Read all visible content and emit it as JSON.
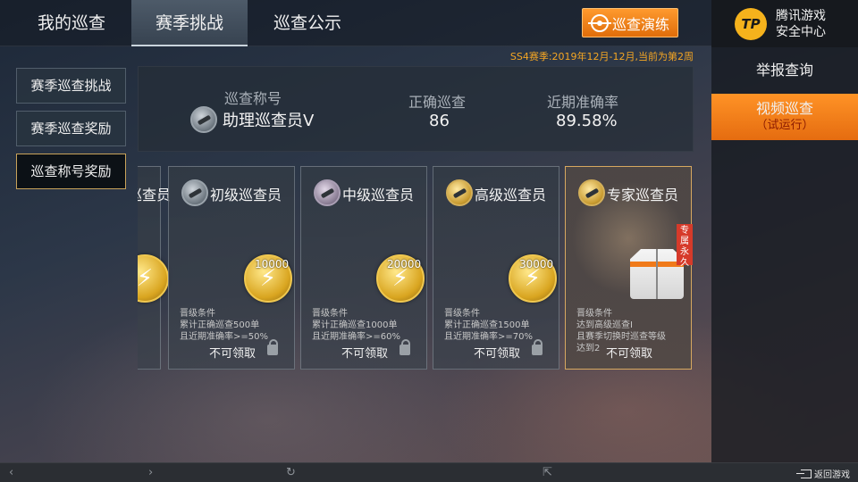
{
  "top_tabs": [
    "我的巡查",
    "赛季挑战",
    "巡查公示"
  ],
  "active_tab": "赛季挑战",
  "drill_button": {
    "label": "巡查演练",
    "icon": "crosshair-icon"
  },
  "season_info": "SS4赛季:2019年12月-12月,当前为第2周",
  "right_panel": {
    "logo_text": "TP",
    "brand_line1": "腾讯游戏",
    "brand_line2": "安全中心",
    "report_label": "举报查询",
    "video_label": "视频巡查",
    "video_sublabel": "（试运行）"
  },
  "side_menu": [
    "赛季巡查挑战",
    "赛季巡查奖励",
    "巡查称号奖励"
  ],
  "active_side": "巡查称号奖励",
  "stats": {
    "title_label": "巡查称号",
    "title_value": "助理巡查员V",
    "correct_label": "正确巡查",
    "correct_value": "86",
    "accuracy_label": "近期准确率",
    "accuracy_value": "89.58%"
  },
  "cards": [
    {
      "title": "巡查员",
      "partial": true
    },
    {
      "title": "初级巡查员",
      "coin_amount": "10000",
      "condition_title": "晋级条件",
      "condition_line1": "累计正确巡查500单",
      "condition_line2": "且近期准确率>=50%",
      "status": "不可领取"
    },
    {
      "title": "中级巡查员",
      "coin_amount": "20000",
      "condition_title": "晋级条件",
      "condition_line1": "累计正确巡查1000单",
      "condition_line2": "且近期准确率>=60%",
      "status": "不可领取"
    },
    {
      "title": "高级巡查员",
      "coin_amount": "30000",
      "condition_title": "晋级条件",
      "condition_line1": "累计正确巡查1500单",
      "condition_line2": "且近期准确率>=70%",
      "status": "不可领取"
    },
    {
      "title": "专家巡查员",
      "tag": "专属永久",
      "condition_title": "晋级条件",
      "condition_line1": "达到高级巡查Ⅰ",
      "condition_line2": "且赛季切换时巡查等级",
      "condition_line3": "达到2",
      "status": "不可领取"
    }
  ],
  "bottom_bar": {
    "back_label": "返回游戏"
  },
  "colors": {
    "accent_orange": "#f5921e",
    "season_text": "#f5a623",
    "selected_border": "#c9a35a"
  }
}
